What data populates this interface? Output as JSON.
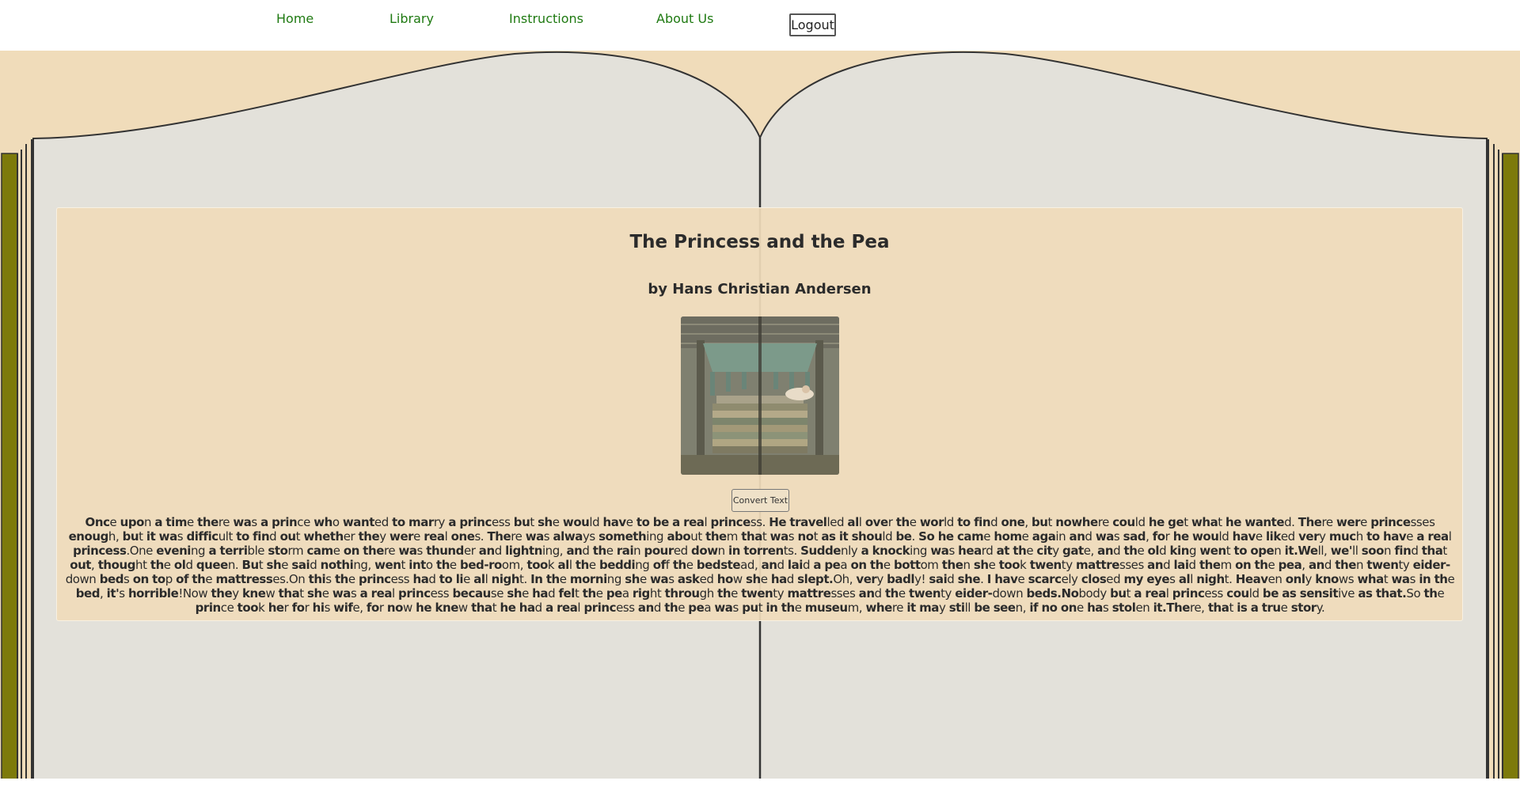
{
  "nav": {
    "home": "Home",
    "library": "Library",
    "instructions": "Instructions",
    "about": "About Us",
    "logout": "Logout"
  },
  "book": {
    "title": "The Princess and the Pea",
    "author": "by Hans Christian Andersen",
    "illustration_icon": "canopy-bed-illustration",
    "convert_label": "Convert Text",
    "story": "Once upon a time there was a prince who wanted to marry a princess but she would have to be a real princess. He travelled all over the world to find one, but nowhere could he get what he wanted. There were princesses enough, but it was difficult to find out whether they were real ones. There was always something about them that was not as it should be. So he came home again and was sad, for he would have liked very much to have a real princess.One evening a terrible storm came on there was thunder and lightning, and the rain poured down in torrents. Suddenly a knocking was heard at the city gate, and the old king went to open it.Well, we'll soon find that out, thought the old queen. But she said nothing, went into the bed-room, took all the bedding off the bedstead, and laid a pea on the bottom then she took twenty mattresses and laid them on the pea, and then twenty eider-down beds on top of the mattresses.On this the princess had to lie all night. In the morning she was asked how she had slept.Oh, very badly! said she. I have scarcely closed my eyes all night. Heaven only knows what was in the bed, it's horrible!Now they knew that she was a real princess because she had felt the pea right through the twenty mattresses and the twenty eider-down beds.Nobody but a real princess could be as sensitive as that.So the prince took her for his wife, for now he knew that he had a real princess and the pea was put in the museum, where it may still be seen, if no one has stolen it.There, that is a true story."
  },
  "colors": {
    "nav_link": "#1f7a12",
    "background": "#f0dcba",
    "page": "#e3e1da",
    "spine": "#7d7a0a"
  }
}
